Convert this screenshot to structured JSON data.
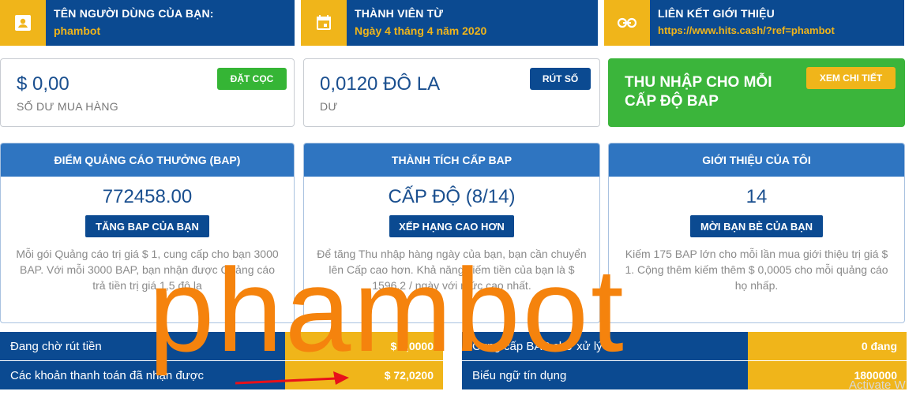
{
  "info": {
    "username_label": "TÊN NGƯỜI DÙNG CỦA BẠN:",
    "username_value": "phambot",
    "member_label": "THÀNH VIÊN TỪ",
    "member_value": "Ngày 4 tháng 4 năm 2020",
    "referral_label": "LIÊN KẾT GIỚI THIỆU",
    "referral_value": "https://www.hits.cash/?ref=phambot"
  },
  "balances": {
    "purchase_amount": "$ 0,00",
    "purchase_label": "SỐ DƯ MUA HÀNG",
    "deposit_button": "ĐẶT CỌC",
    "balance_amount": "0,0120 ĐÔ LA",
    "balance_label": "DƯ",
    "withdraw_button": "RÚT SỐ",
    "earnings_title": "THU NHẬP CHO MỖI CẤP ĐỘ BAP",
    "details_button": "XEM CHI TIẾT"
  },
  "panels": [
    {
      "header": "ĐIỂM QUẢNG CÁO THƯỞNG (BAP)",
      "value": "772458.00",
      "button": "TĂNG BAP CỦA BẠN",
      "description": "Mỗi gói Quảng cáo trị giá $ 1, cung cấp cho bạn 3000 BAP. Với mỗi 3000 BAP, bạn nhận được Quảng cáo trả tiền trị giá 1,5 đô la"
    },
    {
      "header": "THÀNH TÍCH CẤP BAP",
      "value": "CẤP ĐỘ (8/14)",
      "button": "XẾP HẠNG CAO HƠN",
      "description": "Để tăng Thu nhập hàng ngày của bạn, bạn cần chuyển lên Cấp cao hơn. Khả năng kiếm tiền của bạn là $ 1596,2 / ngày với mức cao nhất."
    },
    {
      "header": "GIỚI THIỆU CỦA TÔI",
      "value": "14",
      "button": "MỜI BẠN BÈ CỦA BẠN",
      "description": "Kiếm 175 BAP lớn cho mỗi lần mua giới thiệu trị giá $ 1. Cộng thêm kiếm thêm $ 0,0005 cho mỗi quảng cáo họ nhấp."
    }
  ],
  "rows": {
    "pending_label": "Đang chờ rút tiền",
    "pending_value": "$ 0,0000",
    "received_label": "Các khoản thanh toán đã nhận được",
    "received_value": "$ 72,0200",
    "bap_pending_label": "Cung cấp BAP chờ xử lý",
    "bap_pending_value": "0 đang",
    "credit_label": "Biểu ngữ tín dụng",
    "credit_value": "1800000"
  },
  "watermark": "phambot",
  "corner_text": "Activate W",
  "colors": {
    "navy": "#0b4a91",
    "yellow": "#f0b51a",
    "green": "#35b535",
    "panel_blue": "#2f75c1",
    "watermark": "#f5830d"
  }
}
